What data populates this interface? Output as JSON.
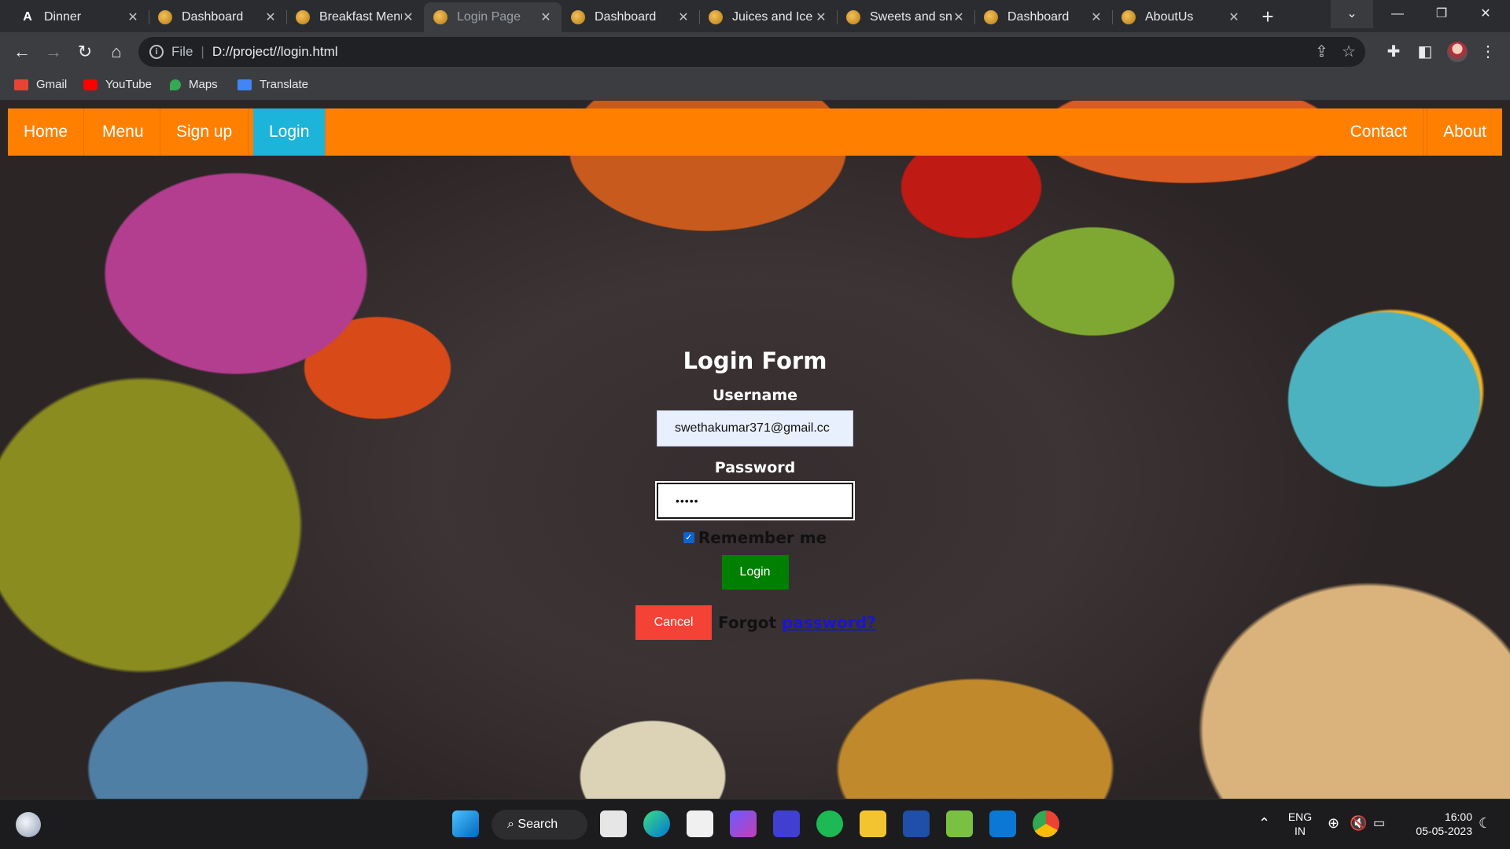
{
  "browser": {
    "tabs": [
      {
        "title": "Dinner",
        "favicon": "a-letter-icon",
        "active": false
      },
      {
        "title": "Dashboard",
        "favicon": "site-icon",
        "active": false
      },
      {
        "title": "Breakfast Menu",
        "favicon": "site-icon",
        "active": false
      },
      {
        "title": "Login Page",
        "favicon": "site-icon",
        "active": true
      },
      {
        "title": "Dashboard",
        "favicon": "site-icon",
        "active": false
      },
      {
        "title": "Juices and Ice",
        "favicon": "site-icon",
        "active": false
      },
      {
        "title": "Sweets and sn",
        "favicon": "site-icon",
        "active": false
      },
      {
        "title": "Dashboard",
        "favicon": "site-icon",
        "active": false
      },
      {
        "title": "AboutUs",
        "favicon": "site-icon",
        "active": false
      }
    ],
    "address": {
      "scheme": "File",
      "url": "D://project//login.html"
    },
    "bookmarks": [
      {
        "label": "Gmail",
        "icon": "gmail-icon",
        "color": "#ea4335"
      },
      {
        "label": "YouTube",
        "icon": "youtube-icon",
        "color": "#ff0000"
      },
      {
        "label": "Maps",
        "icon": "maps-icon",
        "color": "#34a853"
      },
      {
        "label": "Translate",
        "icon": "translate-icon",
        "color": "#4285f4"
      }
    ]
  },
  "page": {
    "nav": {
      "left": [
        "Home",
        "Menu",
        "Sign up",
        "Login"
      ],
      "right": [
        "Contact",
        "About"
      ],
      "active": "Login",
      "bar_color": "#ff8000",
      "active_color": "#1cb5d9"
    },
    "form": {
      "title": "Login Form",
      "username_label": "Username",
      "username_value": "swethakumar371@gmail.cc",
      "password_label": "Password",
      "password_value": "•••••",
      "remember_label": "Remember me",
      "remember_checked": true,
      "login_button": "Login",
      "cancel_button": "Cancel",
      "forgot_prefix": "Forgot",
      "forgot_link": "password?",
      "login_color": "#008000",
      "cancel_color": "#f44336"
    }
  },
  "taskbar": {
    "search_label": "Search",
    "lang_top": "ENG",
    "lang_bottom": "IN",
    "time": "16:00",
    "date": "05-05-2023"
  }
}
